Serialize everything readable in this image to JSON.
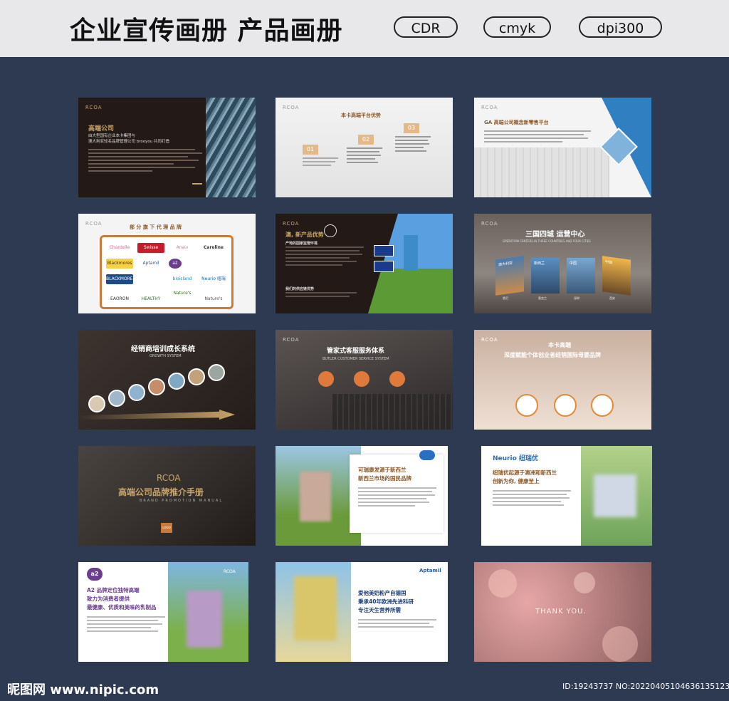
{
  "header": {
    "title": "企业宣传画册 产品画册",
    "tags": [
      "CDR",
      "cmyk",
      "dpi300"
    ]
  },
  "colors": {
    "background": "#2e3a52",
    "topbar": "#e8e8ea",
    "gold": "#c9a46a",
    "brown": "#8a5a2b"
  },
  "cards": {
    "c1": {
      "brand": "RCOA",
      "title": "高端公司",
      "sub1": "由大型国有企业本卡集团与",
      "sub2": "澳大利亚知名品牌管理公司 brooyou 共同打造"
    },
    "c2": {
      "brand": "RCOA",
      "title": "本卡高端平台优势",
      "n1": "01",
      "n2": "02",
      "n3": "03"
    },
    "c3": {
      "brand": "RCOA",
      "title": "GA 高端公司概念新零售平台"
    },
    "c4": {
      "brand": "RCOA",
      "title": "部 分 旗 下 代 理 品 牌",
      "logos": [
        "Chantelle",
        "Swisse",
        "Anaiv",
        "Careline",
        "Blackmores",
        "Aptamil",
        "a2",
        "Neurio 纽瑞优",
        "BLACKMORES",
        "bioisland",
        "Nature's Way",
        "EAORON",
        "HEALTHY BEACH",
        "Nature's Way 佳思敏"
      ]
    },
    "c5": {
      "brand": "RCOA",
      "title": "澳, 新产品优势",
      "s1": "产地的国家监管环境",
      "s2": "我们的供应链优势"
    },
    "c6": {
      "brand": "RCOA",
      "title": "三国四城  运营中心",
      "sub": "OPERATION CENTERS IN THREE COUNTRIES AND FOUR CITIES",
      "cities": [
        "澳大利亚",
        "新西兰",
        "中国",
        "中国"
      ],
      "cities2": [
        "悉尼",
        "奥克兰",
        "深圳",
        "西安"
      ]
    },
    "c7": {
      "title": "经销商培训成长系统",
      "sub": "GROWTH SYSTEM"
    },
    "c8": {
      "brand": "RCOA",
      "title": "管家式客服服务体系",
      "sub": "BUTLER CUSTOMER SERVICE SYSTEM"
    },
    "c9": {
      "brand": "RCOA",
      "t1": "本卡高端",
      "t2": "深度赋能个体创业者经销国际母婴品牌"
    },
    "c10": {
      "brand": "RCOA",
      "title": "高端公司品牌推介手册",
      "sub": "BRAND PROMOTION MANUAL",
      "badge": "LOGO"
    },
    "c11": {
      "t1": "可瑞康发源于新西兰",
      "t2": "新西兰市场的国民品牌"
    },
    "c12": {
      "logo": "Neurio 纽瑞优",
      "t1": "纽瑞优起源于澳洲和新西兰",
      "t2": "创新为你, 健康至上"
    },
    "c13": {
      "logo": "a2",
      "brand": "RCOA",
      "t1": "A2 品牌定位独特高端",
      "t2": "致力为消费者提供",
      "t3": "最健康、优质和美味的乳制品"
    },
    "c14": {
      "logo": "Aptamil",
      "t1": "爱他美奶粉产自德国",
      "t2": "秉承40年欧洲先进科研",
      "t3": "专注天生营养所需"
    },
    "c15": {
      "title": "THANK YOU."
    }
  },
  "footer": {
    "left": "昵图网 www.nipic.com",
    "right": "ID:19243737 NO:20220405104636135123"
  }
}
